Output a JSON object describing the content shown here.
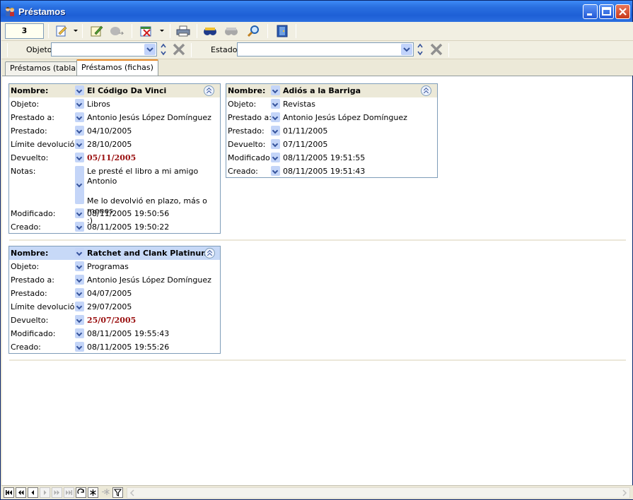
{
  "window": {
    "title": "Préstamos"
  },
  "toolbar": {
    "record_count": "3"
  },
  "filters": {
    "objeto_label": "Objeto",
    "objeto_value": "",
    "estado_label": "Estado",
    "estado_value": ""
  },
  "tabs": [
    {
      "label": "Préstamos (tabla)",
      "active": false
    },
    {
      "label": "Préstamos (fichas)",
      "active": true
    }
  ],
  "labels": {
    "nombre": "Nombre:",
    "objeto": "Objeto:",
    "prestado_a": "Prestado a:",
    "prestado": "Prestado:",
    "limite": "Límite devolución:",
    "devuelto": "Devuelto:",
    "notas": "Notas:",
    "modificado": "Modificado:",
    "creado": "Creado:"
  },
  "cards": [
    {
      "nombre": "El Código Da Vinci",
      "objeto": "Libros",
      "prestado_a": "Antonio Jesús López Domínguez",
      "prestado": "04/10/2005",
      "limite": "28/10/2005",
      "devuelto": "05/11/2005",
      "notas": "Le presté el libro a mi amigo Antonio\n\nMe lo devolvió en plazo, más o menos\n:)",
      "modificado": "08/11/2005 19:50:56",
      "creado": "08/11/2005 19:50:22"
    },
    {
      "nombre": "Adiós a la Barriga",
      "objeto": "Revistas",
      "prestado_a": "Antonio Jesús López Domínguez",
      "prestado": "01/11/2005",
      "devuelto": "07/11/2005",
      "modificado": "08/11/2005 19:51:55",
      "creado": "08/11/2005 19:51:43"
    },
    {
      "nombre": "Ratchet and Clank Platinum",
      "objeto": "Programas",
      "prestado_a": "Antonio Jesús López Domínguez",
      "prestado": "04/07/2005",
      "limite": "29/07/2005",
      "devuelto": "25/07/2005",
      "modificado": "08/11/2005 19:55:43",
      "creado": "08/11/2005 19:55:26"
    }
  ],
  "colors": {
    "title_bar": "#2a6fe0",
    "returned_date": "#9a1010",
    "card_border": "#7f9db9",
    "active_tab_accent": "#e68b2c"
  }
}
